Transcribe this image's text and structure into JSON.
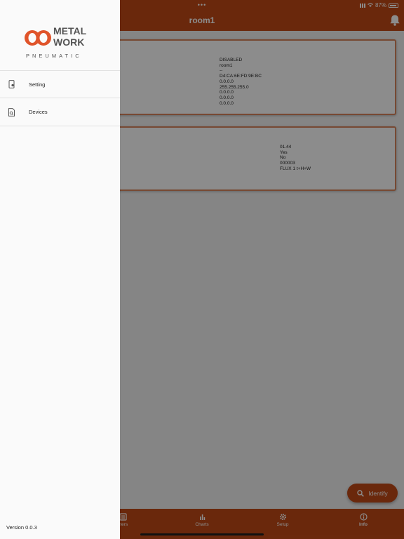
{
  "status_bar": {
    "time": "",
    "dots": "•••",
    "battery": "87%"
  },
  "header": {
    "title": "room1"
  },
  "card1": {
    "values": [
      "DISABLED",
      "room1",
      "--",
      "D4:CA:6E:FD:9E:BC",
      "0.0.0.0",
      "255.255.255.0",
      "0.0.0.0",
      "0.0.0.0",
      "0.0.0.0"
    ]
  },
  "card2": {
    "values": [
      "01.44",
      "Yes",
      "No",
      "000003",
      "FLUX 1 t+H+W"
    ]
  },
  "fab": {
    "label": "Identify",
    "icon": "search-icon"
  },
  "tabs": [
    {
      "label": "Counters",
      "visible_label": "nters",
      "icon": "list-icon",
      "active": false
    },
    {
      "label": "Charts",
      "icon": "bar-chart-icon",
      "active": false
    },
    {
      "label": "Setup",
      "icon": "gear-icon",
      "active": false
    },
    {
      "label": "Info",
      "icon": "info-icon",
      "active": true
    }
  ],
  "drawer": {
    "logo_text": [
      "METAL",
      "WORK",
      "PNEUMATIC"
    ],
    "items": [
      {
        "label": "Setting",
        "icon": "phone-settings-icon"
      },
      {
        "label": "Devices",
        "icon": "device-search-icon"
      }
    ],
    "version": "Version 0.0.3"
  },
  "colors": {
    "brand": "#c24a17",
    "card_border": "#d9865d"
  }
}
